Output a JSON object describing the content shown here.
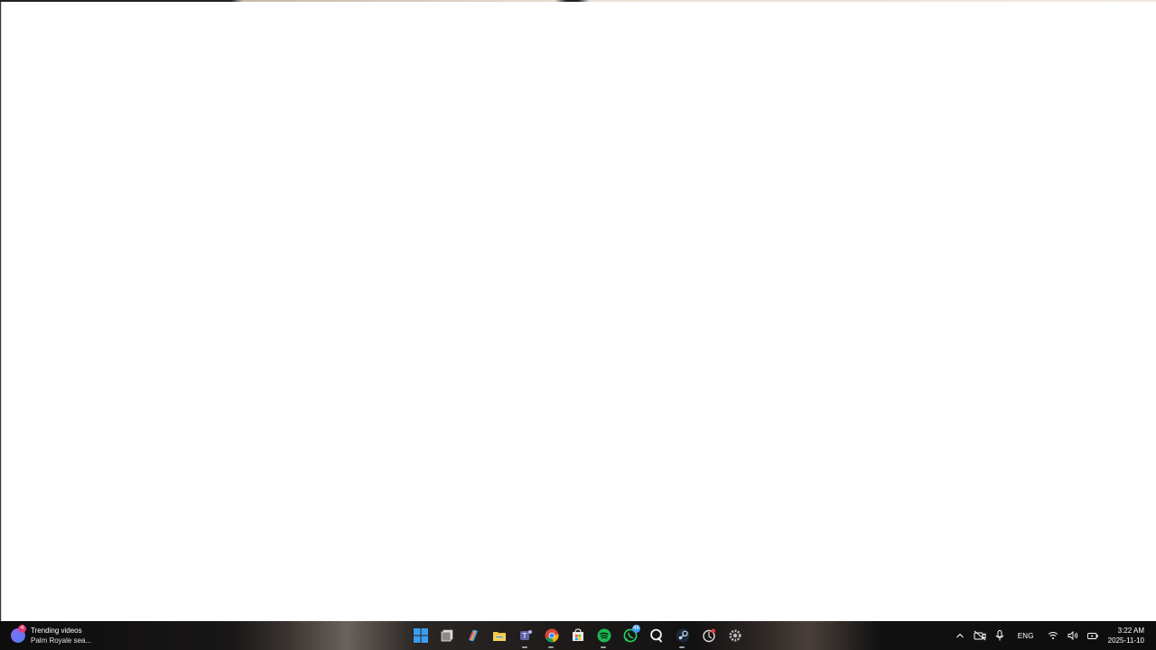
{
  "widget": {
    "badge": "4",
    "title": "Trending videos",
    "subtitle": "Palm Royale sea..."
  },
  "taskbar": {
    "icons": [
      {
        "name": "start-icon"
      },
      {
        "name": "task-view-icon"
      },
      {
        "name": "copilot-icon"
      },
      {
        "name": "file-explorer-icon"
      },
      {
        "name": "teams-icon"
      },
      {
        "name": "chrome-icon"
      },
      {
        "name": "microsoft-store-icon"
      },
      {
        "name": "spotify-icon"
      },
      {
        "name": "whatsapp-icon",
        "badge": "48"
      },
      {
        "name": "search-lens-icon"
      },
      {
        "name": "steam-icon"
      },
      {
        "name": "app-icon"
      },
      {
        "name": "settings-icon"
      }
    ]
  },
  "tray": {
    "language": "ENG",
    "time": "3:22 AM",
    "date": "2025-11-10"
  },
  "colors": {
    "window_bg": "#ffffff",
    "spotify": "#1db954",
    "whatsapp": "#25d366",
    "folder": "#f4c542",
    "windows_blue": "#3b9cf0"
  }
}
